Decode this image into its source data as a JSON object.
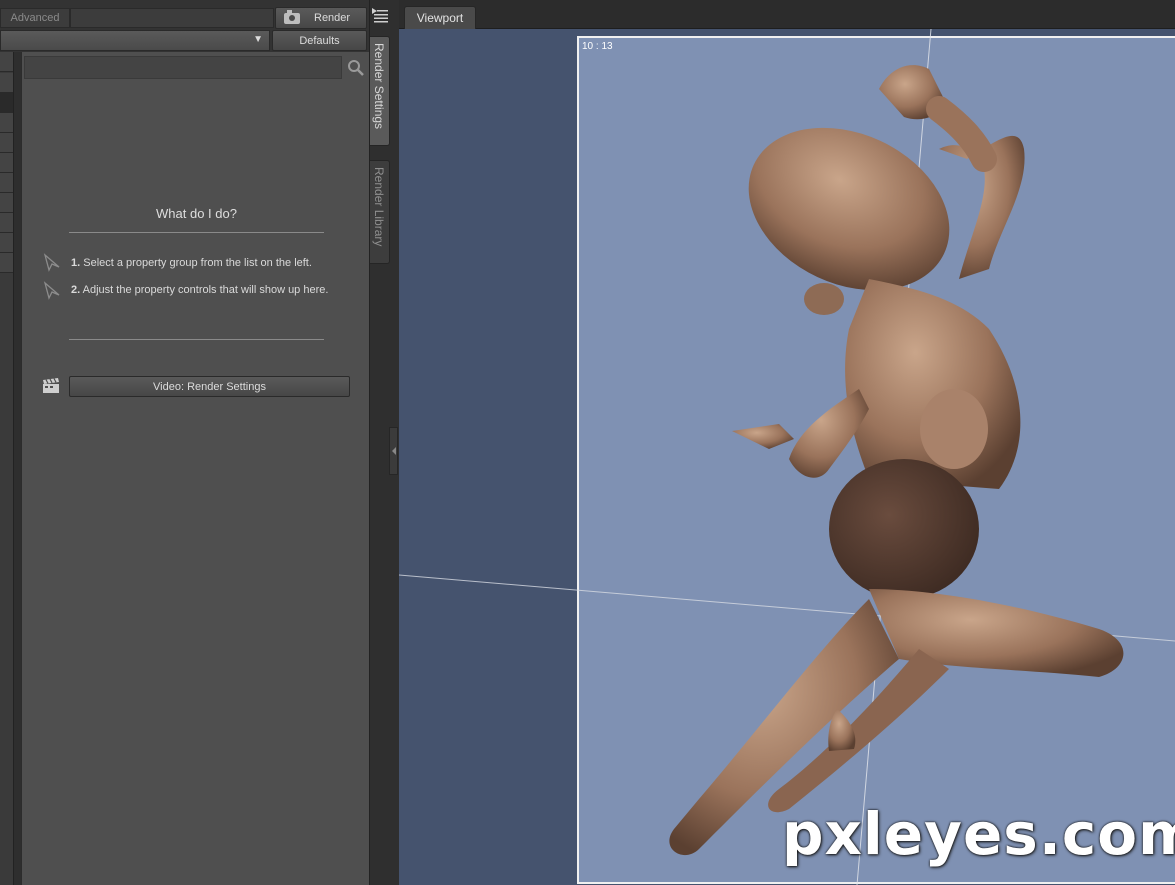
{
  "toolbar": {
    "advanced_label": "Advanced",
    "render_label": "Render",
    "defaults_label": "Defaults"
  },
  "search": {
    "value": "",
    "placeholder": ""
  },
  "help": {
    "title": "What do I do?",
    "step1_num": "1.",
    "step1_text": "Select a property group from the list on the left.",
    "step2_num": "2.",
    "step2_text": "Adjust the property controls that will show up here."
  },
  "video_button_label": "Video: Render Settings",
  "side_tabs": {
    "render_settings": "Render Settings",
    "render_library": "Render Library"
  },
  "viewport": {
    "tab_label": "Viewport",
    "aspect_readout": "10 : 13",
    "watermark": "pxleyes.com"
  },
  "colors": {
    "panel": "#4f4f4f",
    "viewport_bg": "#45536e",
    "render_frame_bg": "#7f91b3",
    "skin": "#a07a62"
  },
  "icons": {
    "camera": "camera-icon",
    "search": "search-icon",
    "pane_menu": "pane-menu-icon",
    "step": "pointer-arrow-icon",
    "clapper": "clapperboard-icon"
  }
}
